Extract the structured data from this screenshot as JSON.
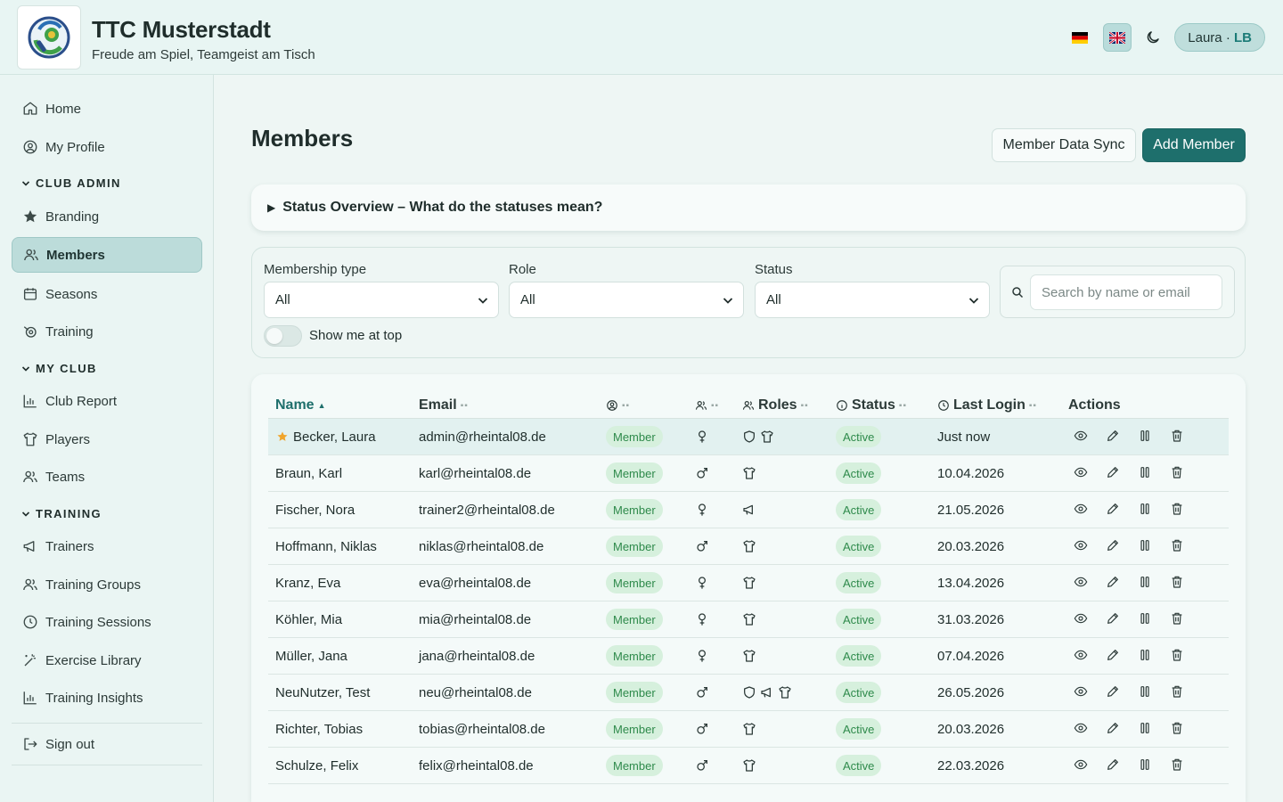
{
  "header": {
    "title": "TTC Musterstadt",
    "tagline": "Freude am Spiel, Teamgeist am Tisch",
    "user": {
      "name": "Laura",
      "sep": " · ",
      "initials": "LB"
    },
    "languages": [
      "de-flag-icon",
      "uk-flag-icon"
    ],
    "active_language": "uk-flag-icon"
  },
  "sidebar": {
    "items": [
      {
        "label": "Home",
        "icon": "home-icon"
      },
      {
        "label": "My Profile",
        "icon": "user-circle-icon"
      }
    ],
    "sections": [
      {
        "title": "CLUB ADMIN",
        "items": [
          {
            "label": "Branding",
            "icon": "star-icon"
          },
          {
            "label": "Members",
            "icon": "users-icon",
            "active": true
          },
          {
            "label": "Seasons",
            "icon": "calendar-icon"
          },
          {
            "label": "Training",
            "icon": "target-icon"
          }
        ]
      },
      {
        "title": "MY CLUB",
        "items": [
          {
            "label": "Club Report",
            "icon": "bar-chart-icon"
          },
          {
            "label": "Players",
            "icon": "shirt-icon"
          },
          {
            "label": "Teams",
            "icon": "users-icon"
          }
        ]
      },
      {
        "title": "TRAINING",
        "items": [
          {
            "label": "Trainers",
            "icon": "megaphone-icon"
          },
          {
            "label": "Training Groups",
            "icon": "users-icon"
          },
          {
            "label": "Training Sessions",
            "icon": "clock-icon"
          },
          {
            "label": "Exercise Library",
            "icon": "wand-icon"
          },
          {
            "label": "Training Insights",
            "icon": "bar-chart-icon"
          }
        ]
      }
    ],
    "sign_out": "Sign out"
  },
  "main": {
    "title": "Members",
    "sync_button": "Member Data Sync",
    "add_button": "Add Member",
    "status_overview": "Status Overview – What do the statuses mean?",
    "filters": {
      "membership_label": "Membership type",
      "membership_value": "All",
      "role_label": "Role",
      "role_value": "All",
      "status_label": "Status",
      "status_value": "All",
      "search_placeholder": "Search by name or email",
      "show_me_label": "Show me at top"
    },
    "table": {
      "headers": {
        "name": "Name",
        "name_sort": "▲",
        "email": "Email",
        "roles": "Roles",
        "status": "Status",
        "last_login": "Last Login",
        "actions": "Actions",
        "sort": "▪▪"
      },
      "rows": [
        {
          "name": "Becker, Laura",
          "email": "admin@rheintal08.de",
          "type": "Member",
          "gender": "female",
          "roles": [
            "shield-icon",
            "shirt-icon"
          ],
          "status": "Active",
          "last_login": "Just now",
          "me": true
        },
        {
          "name": "Braun, Karl",
          "email": "karl@rheintal08.de",
          "type": "Member",
          "gender": "male",
          "roles": [
            "shirt-icon"
          ],
          "status": "Active",
          "last_login": "10.04.2026"
        },
        {
          "name": "Fischer, Nora",
          "email": "trainer2@rheintal08.de",
          "type": "Member",
          "gender": "female",
          "roles": [
            "megaphone-icon"
          ],
          "status": "Active",
          "last_login": "21.05.2026"
        },
        {
          "name": "Hoffmann, Niklas",
          "email": "niklas@rheintal08.de",
          "type": "Member",
          "gender": "male",
          "roles": [
            "shirt-icon"
          ],
          "status": "Active",
          "last_login": "20.03.2026"
        },
        {
          "name": "Kranz, Eva",
          "email": "eva@rheintal08.de",
          "type": "Member",
          "gender": "female",
          "roles": [
            "shirt-icon"
          ],
          "status": "Active",
          "last_login": "13.04.2026"
        },
        {
          "name": "Köhler, Mia",
          "email": "mia@rheintal08.de",
          "type": "Member",
          "gender": "female",
          "roles": [
            "shirt-icon"
          ],
          "status": "Active",
          "last_login": "31.03.2026"
        },
        {
          "name": "Müller, Jana",
          "email": "jana@rheintal08.de",
          "type": "Member",
          "gender": "female",
          "roles": [
            "shirt-icon"
          ],
          "status": "Active",
          "last_login": "07.04.2026"
        },
        {
          "name": "NeuNutzer, Test",
          "email": "neu@rheintal08.de",
          "type": "Member",
          "gender": "male",
          "roles": [
            "shield-icon",
            "megaphone-icon",
            "shirt-icon"
          ],
          "status": "Active",
          "last_login": "26.05.2026"
        },
        {
          "name": "Richter, Tobias",
          "email": "tobias@rheintal08.de",
          "type": "Member",
          "gender": "male",
          "roles": [
            "shirt-icon"
          ],
          "status": "Active",
          "last_login": "20.03.2026"
        },
        {
          "name": "Schulze, Felix",
          "email": "felix@rheintal08.de",
          "type": "Member",
          "gender": "male",
          "roles": [
            "shirt-icon"
          ],
          "status": "Active",
          "last_login": "22.03.2026"
        }
      ]
    }
  },
  "colors": {
    "primary": "#1e6f6c",
    "badge_bg": "#d6f0dd",
    "badge_text": "#2e8a4b",
    "highlight_row": "#e2f1f0"
  }
}
